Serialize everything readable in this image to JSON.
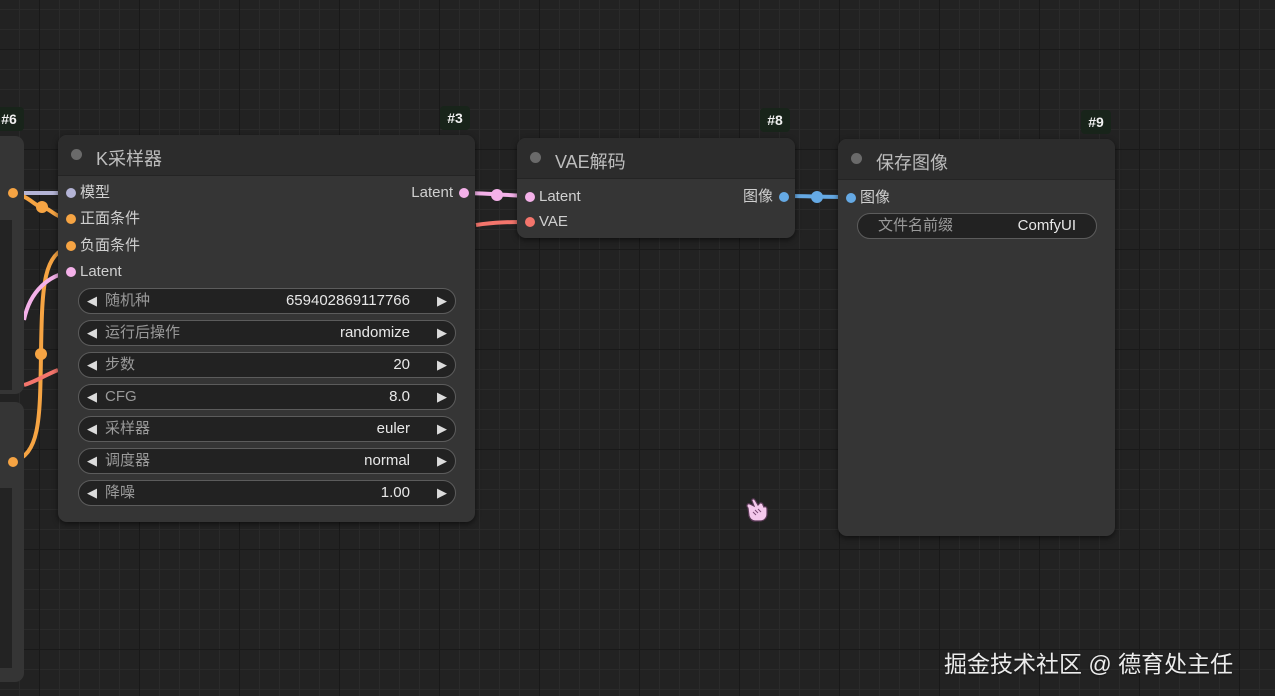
{
  "colors": {
    "model": "#b4b4d6",
    "conditioning": "#f6a443",
    "latent": "#f4b1e9",
    "vae": "#f4756c",
    "image": "#65a9e4"
  },
  "nodes": {
    "left_node_6": {
      "badge": "#6"
    },
    "ksampler": {
      "badge": "#3",
      "title": "K采样器",
      "inputs": [
        "模型",
        "正面条件",
        "负面条件",
        "Latent"
      ],
      "output": "Latent",
      "widgets": [
        {
          "name": "随机种",
          "value": "659402869117766"
        },
        {
          "name": "运行后操作",
          "value": "randomize"
        },
        {
          "name": "步数",
          "value": "20"
        },
        {
          "name": "CFG",
          "value": "8.0"
        },
        {
          "name": "采样器",
          "value": "euler"
        },
        {
          "name": "调度器",
          "value": "normal"
        },
        {
          "name": "降噪",
          "value": "1.00"
        }
      ]
    },
    "vae_decode": {
      "badge": "#8",
      "title": "VAE解码",
      "inputs": [
        "Latent",
        "VAE"
      ],
      "output": "图像"
    },
    "save_image": {
      "badge": "#9",
      "title": "保存图像",
      "inputs": [
        "图像"
      ],
      "widget": {
        "name": "文件名前缀",
        "value": "ComfyUI"
      }
    }
  },
  "icons": {
    "arrow_left": "◀",
    "arrow_right": "▶",
    "pointer": "hand-pointer-icon"
  },
  "watermark": "掘金技术社区 @ 德育处主任"
}
